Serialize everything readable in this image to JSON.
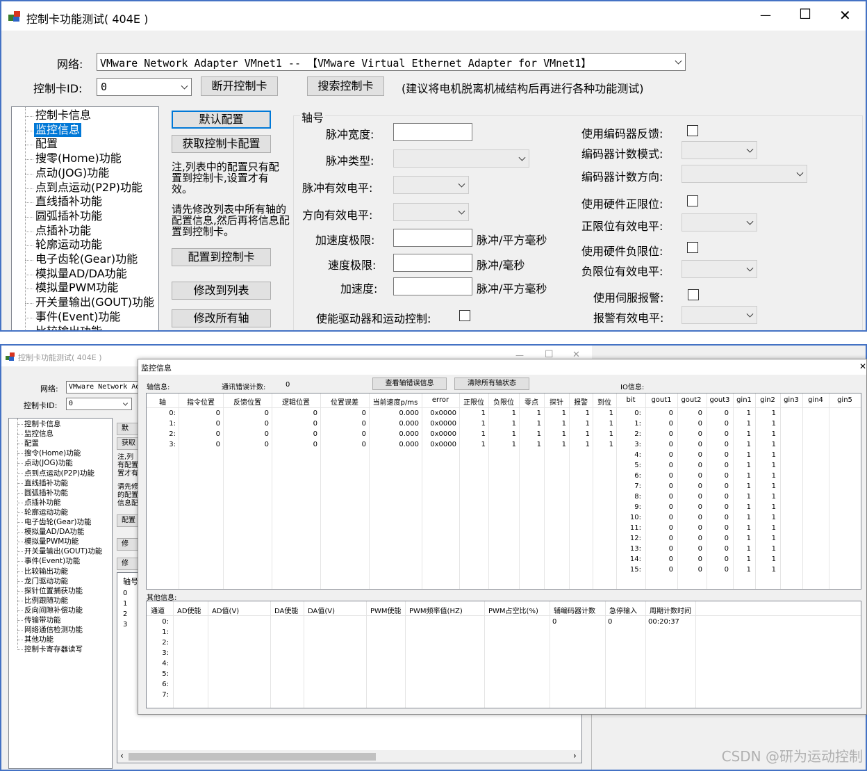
{
  "top": {
    "title": "控制卡功能测试( 404E )",
    "minimize": "—",
    "maximize": "☐",
    "close": "✕",
    "network_label": "网络:",
    "network_value": "VMware Network Adapter VMnet1 -- 【VMware Virtual Ethernet Adapter for VMnet1】",
    "cardid_label": "控制卡ID:",
    "cardid_value": "0",
    "disconnect_btn": "断开控制卡",
    "search_btn": "搜索控制卡",
    "advice": "(建议将电机脱离机械结构后再进行各种功能测试)",
    "tree": [
      "控制卡信息",
      "监控信息",
      "配置",
      "搜零(Home)功能",
      "点动(JOG)功能",
      "点到点运动(P2P)功能",
      "直线插补功能",
      "圆弧插补功能",
      "点插补功能",
      "轮廓运动功能",
      "电子齿轮(Gear)功能",
      "模拟量AD/DA功能",
      "模拟量PWM功能",
      "开关量输出(GOUT)功能",
      "事件(Event)功能",
      "比较输出功能"
    ],
    "btn_default": "默认配置",
    "btn_get": "获取控制卡配置",
    "note1": "注,列表中的配置只有配置到控制卡,设置才有效。",
    "note2": "请先修改列表中所有轴的配置信息,然后再将信息配置到控制卡。",
    "btn_apply": "配置到控制卡",
    "btn_modify": "修改到列表",
    "btn_modify_all": "修改所有轴",
    "axis_label": "轴号",
    "pulse_width": "脉冲宽度:",
    "pulse_type": "脉冲类型:",
    "pulse_level": "脉冲有效电平:",
    "dir_level": "方向有效电平:",
    "acc_limit": "加速度极限:",
    "vel_limit": "速度极限:",
    "acc": "加速度:",
    "unit_acc": "脉冲/平方毫秒",
    "unit_vel": "脉冲/毫秒",
    "enable_drive": "使能驱动器和运动控制:",
    "use_encoder": "使用编码器反馈:",
    "enc_mode": "编码器计数模式:",
    "enc_dir": "编码器计数方向:",
    "use_pos_limit": "使用硬件正限位:",
    "pos_limit_level": "正限位有效电平:",
    "use_neg_limit": "使用硬件负限位:",
    "neg_limit_level": "负限位有效电平:",
    "use_alarm": "使用伺服报警:",
    "alarm_level": "报警有效电平:"
  },
  "bottom": {
    "title": "控制卡功能测试( 404E )",
    "min": "—",
    "max": "☐",
    "close": "✕",
    "network_label": "网络:",
    "network_value": "VMware Network Ad",
    "cardid_label": "控制卡ID:",
    "cardid_value": "0",
    "tree": [
      "控制卡信息",
      "监控信息",
      "配置",
      "搜令(Home)功能",
      "点动(JOG)功能",
      "点到点运动(P2P)功能",
      "直线插补功能",
      "圆弧插补功能",
      "点插补功能",
      "轮廓运动功能",
      "电子齿轮(Gear)功能",
      "模拟量AD/DA功能",
      "模拟量PWM功能",
      "开关量输出(GOUT)功能",
      "事件(Event)功能",
      "比较输出功能",
      "龙门驱动功能",
      "探针位置捕获功能",
      "比例跟随功能",
      "反向间隙补偿功能",
      "传输带功能",
      "网络通信检测功能",
      "其他功能",
      "控制卡寄存器读写"
    ],
    "btn_frag": [
      "默",
      "获取",
      "配置",
      "修",
      "修"
    ],
    "note_frag1": "注,列有配置置才有",
    "note_frag2": "请先修的配置信息配",
    "axis_col": "轴号",
    "axis_rows": [
      "0",
      "1",
      "2",
      "3"
    ],
    "scroll_left": "‹",
    "scroll_right": "›"
  },
  "monitor": {
    "title": "监控信息",
    "close": "✕",
    "axis_info": "轴信息:",
    "comm_err_label": "通讯错误计数:",
    "comm_err_value": "0",
    "btn_view_err": "查看轴错误信息",
    "btn_clear": "清除所有轴状态",
    "io_info": "IO信息:",
    "axis_headers": [
      "轴",
      "指令位置",
      "反馈位置",
      "逻辑位置",
      "位置误差",
      "当前速度p/ms",
      "error",
      "正限位",
      "负限位",
      "零点",
      "探针",
      "报警",
      "到位"
    ],
    "axis_rows": [
      [
        "0:",
        "0",
        "0",
        "0",
        "0",
        "0.000",
        "0x0000",
        "1",
        "1",
        "1",
        "1",
        "1",
        "1"
      ],
      [
        "1:",
        "0",
        "0",
        "0",
        "0",
        "0.000",
        "0x0000",
        "1",
        "1",
        "1",
        "1",
        "1",
        "1"
      ],
      [
        "2:",
        "0",
        "0",
        "0",
        "0",
        "0.000",
        "0x0000",
        "1",
        "1",
        "1",
        "1",
        "1",
        "1"
      ],
      [
        "3:",
        "0",
        "0",
        "0",
        "0",
        "0.000",
        "0x0000",
        "1",
        "1",
        "1",
        "1",
        "1",
        "1"
      ]
    ],
    "io_headers": [
      "bit",
      "gout1",
      "gout2",
      "gout3",
      "gin1",
      "gin2",
      "gin3",
      "gin4",
      "gin5"
    ],
    "io_rows": [
      [
        "0:",
        "0",
        "0",
        "0",
        "1",
        "1"
      ],
      [
        "1:",
        "0",
        "0",
        "0",
        "1",
        "1"
      ],
      [
        "2:",
        "0",
        "0",
        "0",
        "1",
        "1"
      ],
      [
        "3:",
        "0",
        "0",
        "0",
        "1",
        "1"
      ],
      [
        "4:",
        "0",
        "0",
        "0",
        "1",
        "1"
      ],
      [
        "5:",
        "0",
        "0",
        "0",
        "1",
        "1"
      ],
      [
        "6:",
        "0",
        "0",
        "0",
        "1",
        "1"
      ],
      [
        "7:",
        "0",
        "0",
        "0",
        "1",
        "1"
      ],
      [
        "8:",
        "0",
        "0",
        "0",
        "1",
        "1"
      ],
      [
        "9:",
        "0",
        "0",
        "0",
        "1",
        "1"
      ],
      [
        "10:",
        "0",
        "0",
        "0",
        "1",
        "1"
      ],
      [
        "11:",
        "0",
        "0",
        "0",
        "1",
        "1"
      ],
      [
        "12:",
        "0",
        "0",
        "0",
        "1",
        "1"
      ],
      [
        "13:",
        "0",
        "0",
        "0",
        "1",
        "1"
      ],
      [
        "14:",
        "0",
        "0",
        "0",
        "1",
        "1"
      ],
      [
        "15:",
        "0",
        "0",
        "0",
        "1",
        "1"
      ]
    ],
    "other_info": "其他信息:",
    "other_headers": [
      "通道",
      "AD使能",
      "AD值(V)",
      "DA使能",
      "DA值(V)",
      "PWM使能",
      "PWM频率值(HZ)",
      "PWM占空比(%)",
      "辅编码器计数",
      "急停输入",
      "周期计数时间"
    ],
    "other_rows": [
      "0:",
      "1:",
      "2:",
      "3:",
      "4:",
      "5:",
      "6:",
      "7:"
    ],
    "aux_enc_value": "0",
    "estop_value": "0",
    "cycle_time_value": "00:20:37"
  },
  "watermark": "CSDN @研为运动控制"
}
